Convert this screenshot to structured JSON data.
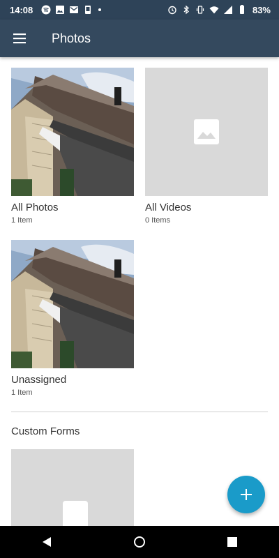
{
  "status_bar": {
    "time": "14:08",
    "battery": "83%"
  },
  "app_bar": {
    "title": "Photos",
    "menu_icon": "hamburger-menu-icon"
  },
  "albums": [
    {
      "title": "All Photos",
      "count": "1 Item",
      "thumbnail": "house-roof-photo"
    },
    {
      "title": "All Videos",
      "count": "0 Items",
      "thumbnail": "image-placeholder-icon"
    },
    {
      "title": "Unassigned",
      "count": "1 Item",
      "thumbnail": "house-roof-photo"
    }
  ],
  "custom_forms": {
    "section_title": "Custom Forms"
  },
  "fab": {
    "icon": "plus-icon"
  },
  "colors": {
    "status_bar": "#2e4358",
    "app_bar": "#34495e",
    "fab": "#1a9bc9",
    "placeholder": "#d9d9d9"
  }
}
